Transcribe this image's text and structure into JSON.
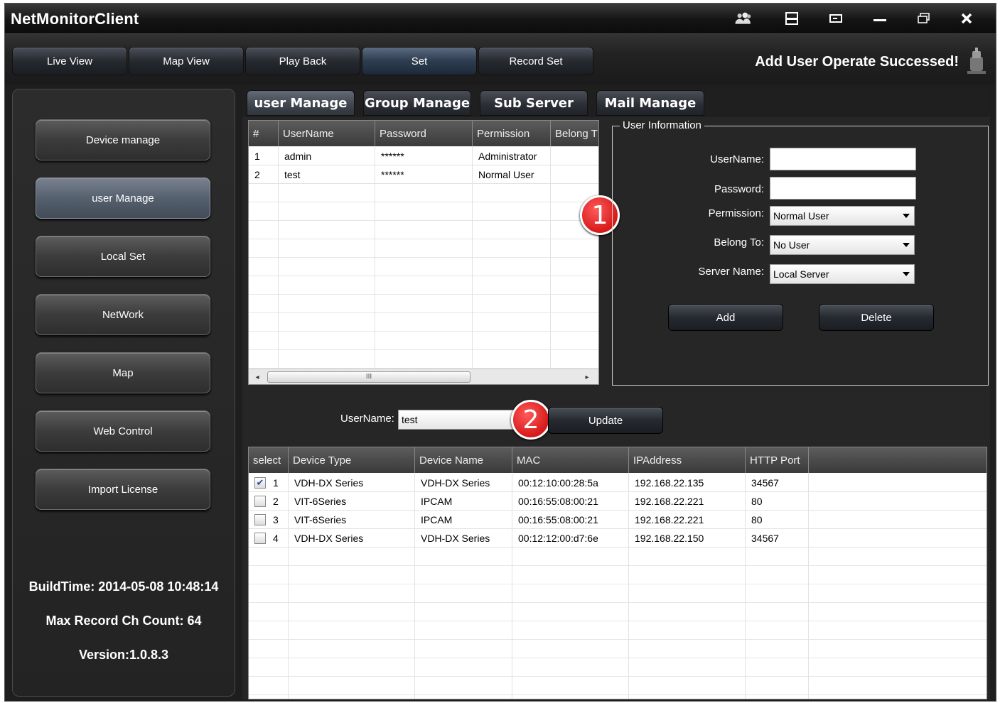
{
  "app": {
    "title": "NetMonitorClient"
  },
  "titlebar_icons": [
    "users-icon",
    "minimize-to-tray-icon",
    "restore-icon",
    "minimize-icon",
    "maximize-icon",
    "close-icon"
  ],
  "nav": {
    "tabs": [
      "Live View",
      "Map View",
      "Play Back",
      "Set",
      "Record Set"
    ],
    "active": "Set",
    "status_message": "Add User Operate Successed!"
  },
  "sidebar": {
    "items": [
      "Device manage",
      "user Manage",
      "Local Set",
      "NetWork",
      "Map",
      "Web Control",
      "Import License"
    ],
    "active": "user Manage",
    "build_time": "BuildTime: 2014-05-08 10:48:14",
    "max_record": "Max Record Ch Count: 64",
    "version": "Version:1.0.8.3"
  },
  "sub_tabs": [
    "user Manage",
    "Group Manage",
    "Sub Server",
    "Mail Manage"
  ],
  "user_table": {
    "columns": [
      "#",
      "UserName",
      "Password",
      "Permission",
      "Belong T"
    ],
    "rows": [
      [
        "1",
        "admin",
        "******",
        "Administrator",
        ""
      ],
      [
        "2",
        "test",
        "******",
        "Normal User",
        ""
      ]
    ],
    "scroll_thumb_label": "III"
  },
  "markers": [
    "1",
    "2"
  ],
  "user_info": {
    "legend": "User Information",
    "username_label": "UserName:",
    "password_label": "Password:",
    "permission_label": "Permission:",
    "belong_label": "Belong To:",
    "server_label": "Server Name:",
    "username_value": "",
    "password_value": "",
    "permission_value": "Normal User",
    "belong_value": "No User",
    "server_value": "Local Server",
    "add_label": "Add",
    "delete_label": "Delete"
  },
  "update_row": {
    "label": "UserName:",
    "value": "test",
    "button": "Update"
  },
  "device_table": {
    "columns": [
      "select",
      "Device Type",
      "Device Name",
      "MAC",
      "IPAddress",
      "HTTP Port"
    ],
    "rows": [
      {
        "checked": true,
        "num": "1",
        "type": "VDH-DX Series",
        "name": "VDH-DX Series",
        "mac": "00:12:10:00:28:5a",
        "ip": "192.168.22.135",
        "port": "34567"
      },
      {
        "checked": false,
        "num": "2",
        "type": "VIT-6Series",
        "name": "IPCAM",
        "mac": "00:16:55:08:00:21",
        "ip": "192.168.22.221",
        "port": "80"
      },
      {
        "checked": false,
        "num": "3",
        "type": "VIT-6Series",
        "name": "IPCAM",
        "mac": "00:16:55:08:00:21",
        "ip": "192.168.22.221",
        "port": "80"
      },
      {
        "checked": false,
        "num": "4",
        "type": "VDH-DX Series",
        "name": "VDH-DX Series",
        "mac": "00:12:12:00:d7:6e",
        "ip": "192.168.22.150",
        "port": "34567"
      }
    ]
  }
}
